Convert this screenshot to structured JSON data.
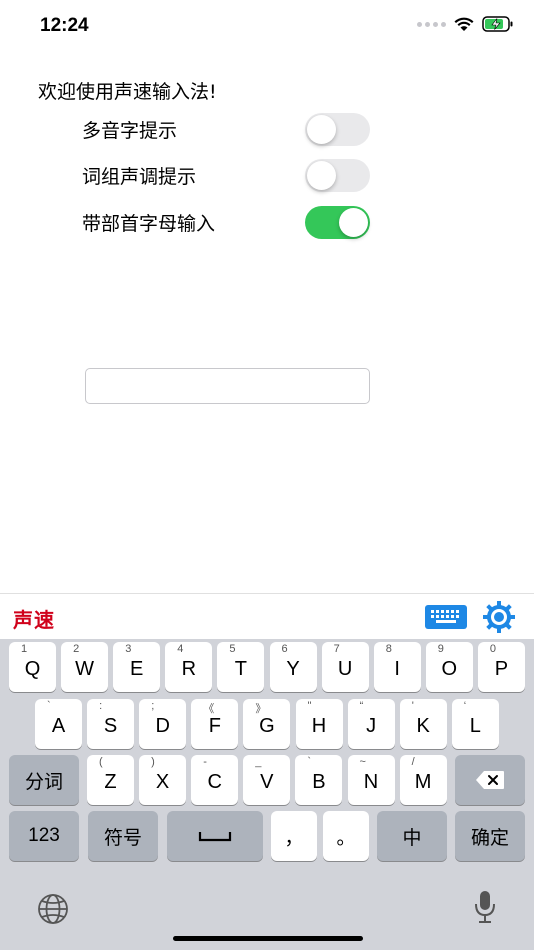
{
  "status": {
    "time": "12:24"
  },
  "welcome": "欢迎使用声速输入法!",
  "settings": [
    {
      "label": "多音字提示",
      "on": false
    },
    {
      "label": "词组声调提示",
      "on": false
    },
    {
      "label": "带部首字母输入",
      "on": true
    }
  ],
  "input": {
    "value": "",
    "placeholder": ""
  },
  "toolbar": {
    "brand": "声速",
    "keyboard_icon": "keyboard-icon",
    "settings_icon": "gear-icon"
  },
  "keyboard": {
    "row1": [
      {
        "hint": "1",
        "label": "Q"
      },
      {
        "hint": "2",
        "label": "W"
      },
      {
        "hint": "3",
        "label": "E"
      },
      {
        "hint": "4",
        "label": "R"
      },
      {
        "hint": "5",
        "label": "T"
      },
      {
        "hint": "6",
        "label": "Y"
      },
      {
        "hint": "7",
        "label": "U"
      },
      {
        "hint": "8",
        "label": "I"
      },
      {
        "hint": "9",
        "label": "O"
      },
      {
        "hint": "0",
        "label": "P"
      }
    ],
    "row2": [
      {
        "hint": "`",
        "label": "A"
      },
      {
        "hint": ":",
        "label": "S"
      },
      {
        "hint": ";",
        "label": "D"
      },
      {
        "hint": "《",
        "label": "F"
      },
      {
        "hint": "》",
        "label": "G"
      },
      {
        "hint": "\"",
        "label": "H"
      },
      {
        "hint": "“",
        "label": "J"
      },
      {
        "hint": "'",
        "label": "K"
      },
      {
        "hint": "‘",
        "label": "L"
      }
    ],
    "row3": [
      {
        "hint": "(",
        "label": "Z"
      },
      {
        "hint": ")",
        "label": "X"
      },
      {
        "hint": "-",
        "label": "C"
      },
      {
        "hint": "_",
        "label": "V"
      },
      {
        "hint": "`",
        "label": "B"
      },
      {
        "hint": "~",
        "label": "N"
      },
      {
        "hint": "/",
        "label": "M"
      }
    ],
    "segment_label": "分词",
    "numbers_label": "123",
    "symbols_label": "符号",
    "space_label": "␣",
    "comma_label": "，",
    "period_label": "。",
    "chinese_label": "中",
    "confirm_label": "确定",
    "delete_icon": "backspace-icon",
    "globe_icon": "globe-icon",
    "mic_icon": "microphone-icon"
  }
}
